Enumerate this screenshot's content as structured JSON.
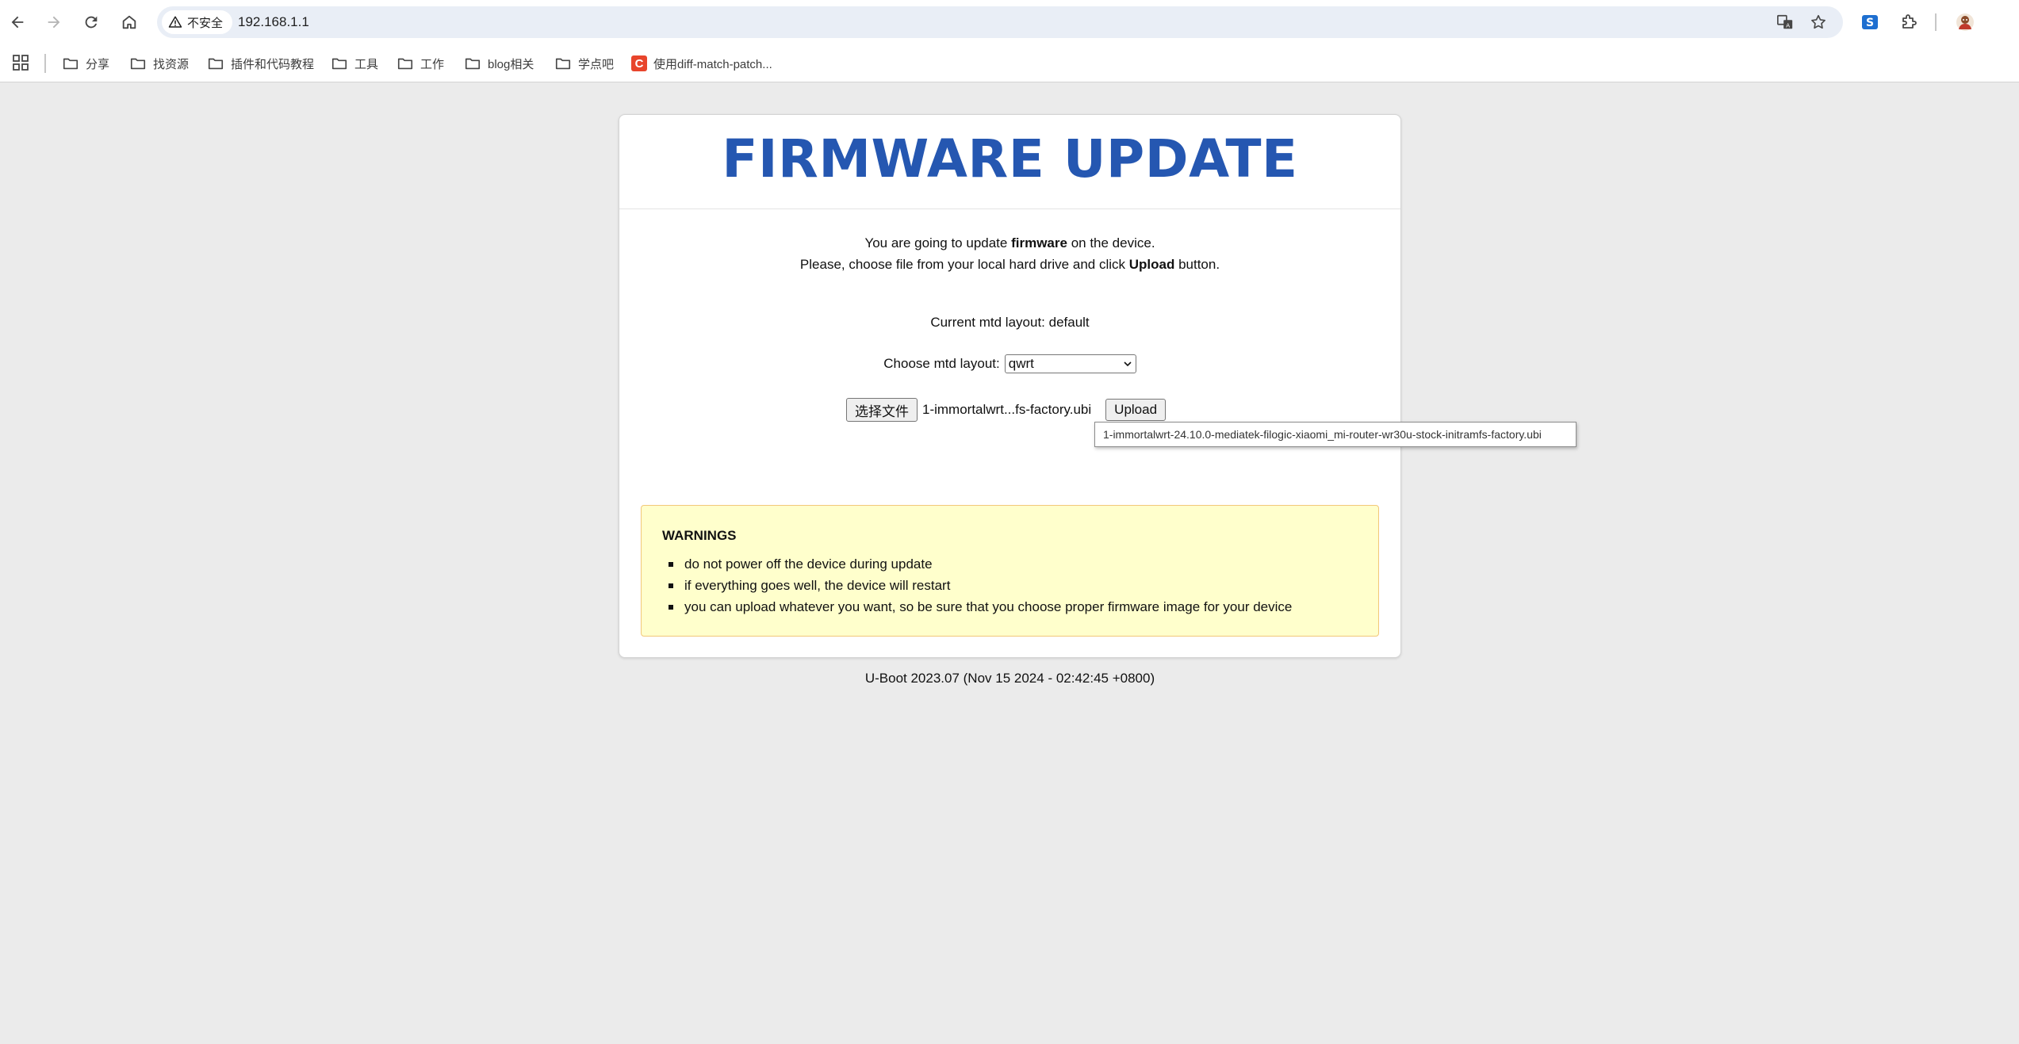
{
  "browser": {
    "security_label": "不安全",
    "url": "192.168.1.1"
  },
  "bookmarks": [
    {
      "label": "分享",
      "icon": "folder-icon"
    },
    {
      "label": "找资源",
      "icon": "folder-icon"
    },
    {
      "label": "插件和代码教程",
      "icon": "folder-icon"
    },
    {
      "label": "工具",
      "icon": "folder-icon"
    },
    {
      "label": "工作",
      "icon": "folder-icon"
    },
    {
      "label": "blog相关",
      "icon": "folder-icon"
    },
    {
      "label": "学点吧",
      "icon": "folder-icon"
    },
    {
      "label": "使用diff-match-patch...",
      "icon": "site-favicon",
      "badge": "C"
    }
  ],
  "page": {
    "title": "FIRMWARE UPDATE",
    "intro1_pre": "You are going to update ",
    "intro1_bold": "firmware",
    "intro1_post": " on the device.",
    "intro2_pre": "Please, choose file from your local hard drive and click ",
    "intro2_bold": "Upload",
    "intro2_post": " button.",
    "current_layout": "Current mtd layout: default",
    "choose_label": "Choose mtd layout:",
    "layout_selected": "qwrt",
    "file_button": "选择文件",
    "file_name": "1-immortalwrt...fs-factory.ubi",
    "upload_button": "Upload",
    "tooltip": "1-immortalwrt-24.10.0-mediatek-filogic-xiaomi_mi-router-wr30u-stock-initramfs-factory.ubi",
    "warnings_title": "WARNINGS",
    "warnings": [
      "do not power off the device during update",
      "if everything goes well, the device will restart",
      "you can upload whatever you want, so be sure that you choose proper firmware image for your device"
    ],
    "footer": "U-Boot 2023.07 (Nov 15 2024 - 02:42:45 +0800)"
  },
  "colors": {
    "title": "#2557b1",
    "warning_bg": "#ffffcc",
    "warning_border": "#f2c879",
    "page_bg": "#ebebeb",
    "favicon": "#e8452c"
  }
}
